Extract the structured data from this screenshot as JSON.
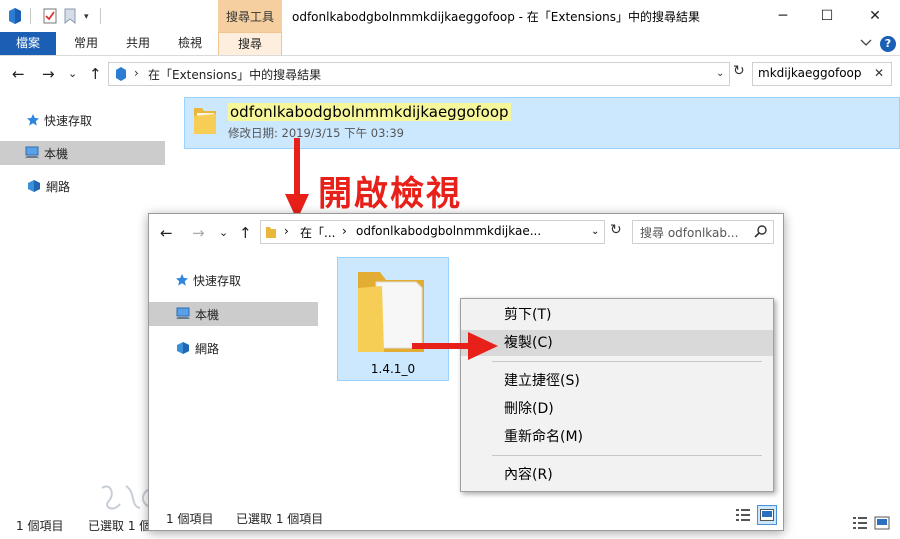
{
  "outer": {
    "window_title": "odfonlkabodgbolnmmkdijkaeggofoop - 在「Extensions」中的搜尋結果",
    "context_tab_group": "搜尋工具",
    "qat_dropdown": "▾",
    "window_controls": {
      "minimize": "─",
      "maximize": "☐",
      "close": "✕"
    },
    "ribbon_tabs": [
      {
        "label": "檔案"
      },
      {
        "label": "常用"
      },
      {
        "label": "共用"
      },
      {
        "label": "檢視"
      },
      {
        "label": "搜尋"
      }
    ],
    "help_label": "?",
    "nav": {
      "back": "←",
      "forward": "→",
      "recent": "⌄",
      "up": "↑"
    },
    "address": {
      "separator": "›",
      "text": "在「Extensions」中的搜尋結果",
      "dropdown": "⌄",
      "refresh": "↻"
    },
    "search": {
      "value": "mkdijkaeggofoop",
      "clear": "✕"
    },
    "nav_pane": [
      {
        "label": "快速存取",
        "icon": "star-icon"
      },
      {
        "label": "本機",
        "icon": "computer-icon"
      },
      {
        "label": "網路",
        "icon": "network-icon"
      }
    ],
    "result": {
      "name": "odfonlkabodgbolnmmkdijkaeggofoop",
      "date": "修改日期: 2019/3/15 下午 03:39"
    },
    "status": {
      "item_count": "1 個項目",
      "selected": "已選取 1 個"
    }
  },
  "annotation": {
    "label": "開啟檢視",
    "color": "#e8201a"
  },
  "inner": {
    "nav": {
      "back": "←",
      "forward": "→",
      "recent": "⌄",
      "up": "↑"
    },
    "address": {
      "sep1": "›",
      "segment1": "在「...",
      "sep2": "›",
      "segment2": "odfonlkabodgbolnmmkdijkae...",
      "dropdown": "⌄",
      "refresh": "↻"
    },
    "search_placeholder": "搜尋 odfonlkab...",
    "nav_pane": [
      {
        "label": "快速存取",
        "icon": "star-icon"
      },
      {
        "label": "本機",
        "icon": "computer-icon"
      },
      {
        "label": "網路",
        "icon": "network-icon"
      }
    ],
    "folder": {
      "label": "1.4.1_0"
    },
    "status": {
      "item_count": "1 個項目",
      "selected": "已選取 1 個項目"
    }
  },
  "context_menu": [
    {
      "label": "剪下(T)"
    },
    {
      "label": "複製(C)"
    },
    {
      "label": "建立捷徑(S)"
    },
    {
      "label": "刪除(D)"
    },
    {
      "label": "重新命名(M)"
    },
    {
      "label": "內容(R)"
    }
  ],
  "colors": {
    "accent": "#1a5fb4",
    "selection": "#cce8ff",
    "highlight": "#f6f69a",
    "arrow": "#e8201a"
  }
}
